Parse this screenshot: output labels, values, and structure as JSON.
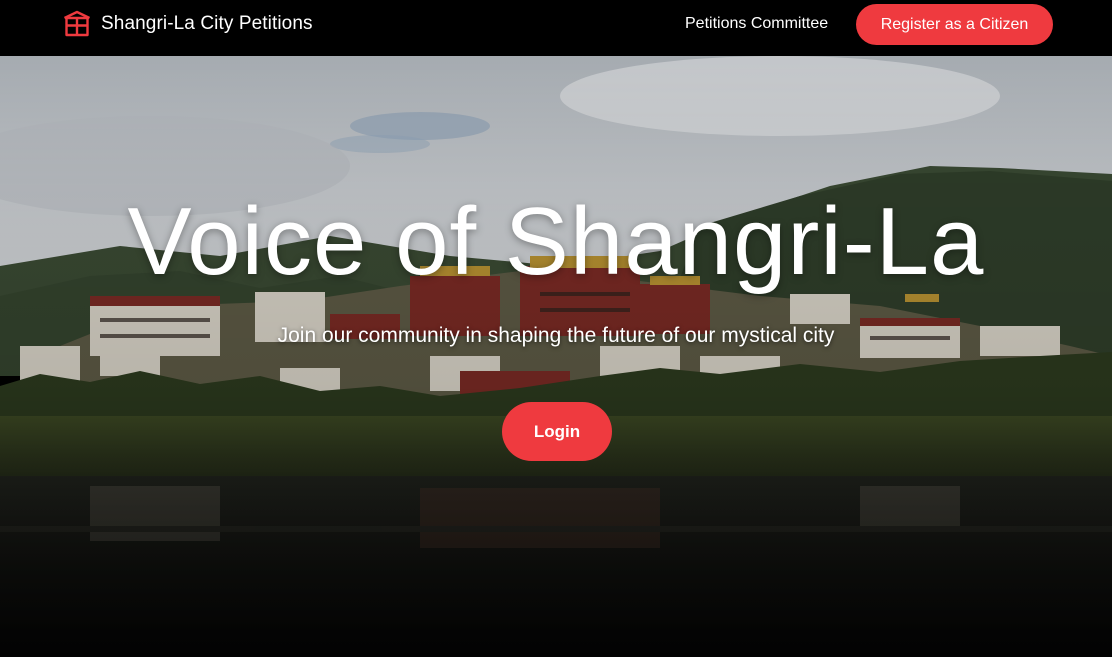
{
  "navbar": {
    "brand_name": "Shangri-La City Petitions",
    "brand_icon": "temple-gate-icon",
    "committee_link": "Petitions Committee",
    "register_button": "Register as a Citizen"
  },
  "hero": {
    "title": "Voice of Shangri-La",
    "subtitle": "Join our community in shaping the future of our mystical city",
    "login_button": "Login",
    "background": "photo of Ganden Sumtseling monastery on a hillside reflected in a lake"
  },
  "colors": {
    "accent": "#ef3a3f",
    "navbar_bg": "#000000",
    "text": "#ffffff"
  }
}
